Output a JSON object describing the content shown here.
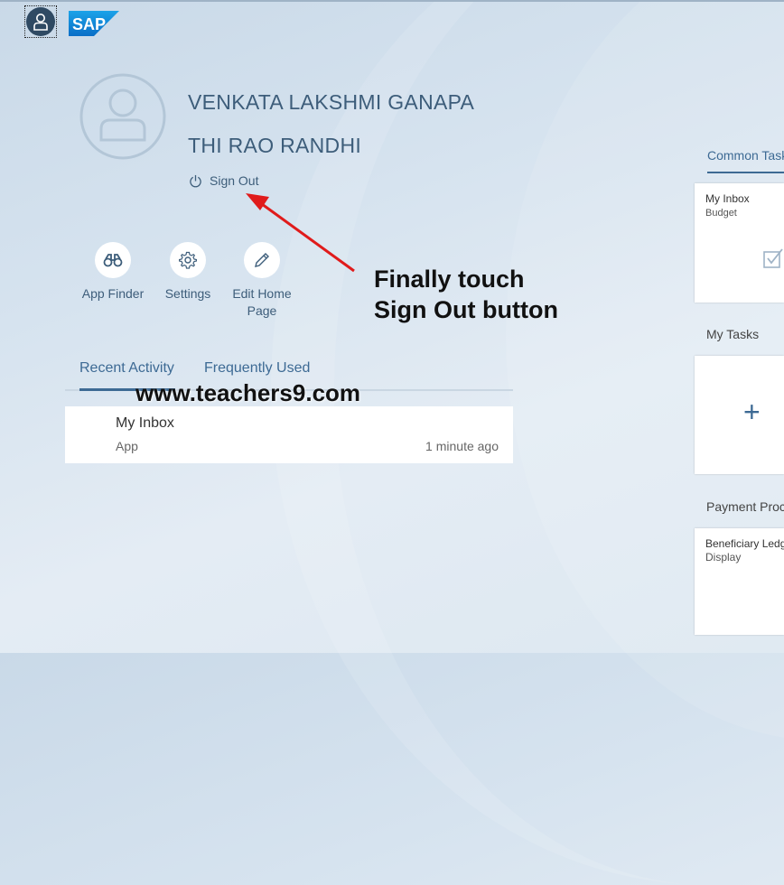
{
  "header": {
    "logo_text": "SAP"
  },
  "user": {
    "name_line1": "VENKATA LAKSHMI GANAPA",
    "name_line2": "THI RAO RANDHI",
    "sign_out_label": "Sign Out"
  },
  "actions": [
    {
      "label": "App Finder",
      "icon": "binoculars-icon"
    },
    {
      "label": "Settings",
      "icon": "gear-icon"
    },
    {
      "label": "Edit Home Page",
      "icon": "pencil-icon"
    }
  ],
  "tabs": [
    {
      "label": "Recent Activity",
      "active": true
    },
    {
      "label": "Frequently Used",
      "active": false
    }
  ],
  "recent": [
    {
      "title": "My Inbox",
      "type": "App",
      "time": "1 minute ago"
    }
  ],
  "annotation": {
    "line1": "Finally touch",
    "line2": "Sign Out button"
  },
  "watermark": "www.teachers9.com",
  "right_panel": {
    "common_tasks_label": "Common Task",
    "tile1_title": "My Inbox",
    "tile1_sub": "Budget",
    "my_tasks_label": "My Tasks",
    "add_tile_symbol": "+",
    "payment_label": "Payment Proc",
    "tile3_title": "Beneficiary Ledg",
    "tile3_sub": "Display"
  },
  "colors": {
    "accent": "#3d6a94",
    "text_blue": "#3d5d7a",
    "arrow": "#e01b1b"
  }
}
